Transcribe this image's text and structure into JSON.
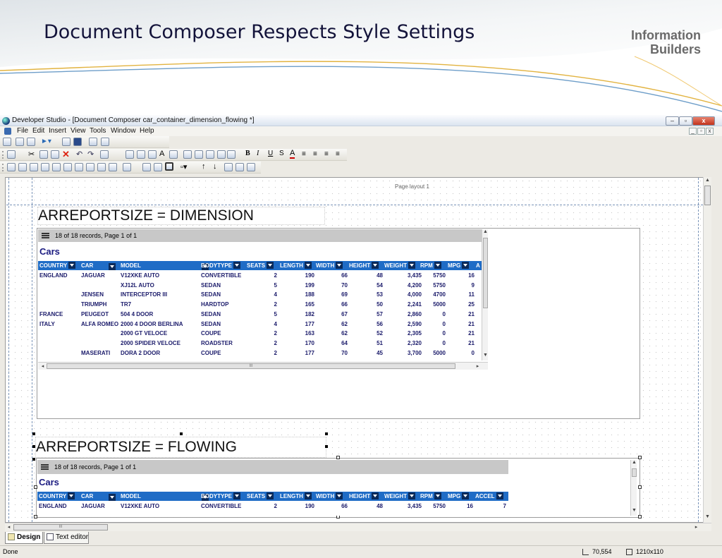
{
  "slide": {
    "title": "Document Composer Respects Style Settings",
    "logo_line1": "Information",
    "logo_line2": "Builders"
  },
  "window": {
    "title": "Developer Studio - [Document Composer car_container_dimension_flowing *]",
    "controls": [
      "–",
      "▫",
      "x"
    ],
    "mdi_controls": [
      "_",
      "▫",
      "x"
    ]
  },
  "menu": [
    "File",
    "Edit",
    "Insert",
    "View",
    "Tools",
    "Window",
    "Help"
  ],
  "format_toolbar": {
    "bold": "B",
    "italic": "I",
    "underline": "U",
    "strike": "S",
    "color": "A"
  },
  "canvas": {
    "page_label": "Page layout 1"
  },
  "report1": {
    "title": "ARREPORTSIZE = DIMENSION",
    "pager": "18 of 18 records, Page 1 of 1",
    "heading": "Cars",
    "columns": [
      "COUNTRY",
      "CAR",
      "MODEL",
      "BODYTYPE",
      "SEATS",
      "LENGTH",
      "WIDTH",
      "HEIGHT",
      "WEIGHT",
      "RPM",
      "MPG",
      "A"
    ],
    "rows": [
      [
        "ENGLAND",
        "JAGUAR",
        "V12XKE AUTO",
        "CONVERTIBLE",
        "2",
        "190",
        "66",
        "48",
        "3,435",
        "5750",
        "16"
      ],
      [
        "",
        "",
        "XJ12L AUTO",
        "SEDAN",
        "5",
        "199",
        "70",
        "54",
        "4,200",
        "5750",
        "9"
      ],
      [
        "",
        "JENSEN",
        "INTERCEPTOR III",
        "SEDAN",
        "4",
        "188",
        "69",
        "53",
        "4,000",
        "4700",
        "11"
      ],
      [
        "",
        "TRIUMPH",
        "TR7",
        "HARDTOP",
        "2",
        "165",
        "66",
        "50",
        "2,241",
        "5000",
        "25"
      ],
      [
        "FRANCE",
        "PEUGEOT",
        "504 4 DOOR",
        "SEDAN",
        "5",
        "182",
        "67",
        "57",
        "2,860",
        "0",
        "21"
      ],
      [
        "ITALY",
        "ALFA ROMEO",
        "2000 4 DOOR BERLINA",
        "SEDAN",
        "4",
        "177",
        "62",
        "56",
        "2,590",
        "0",
        "21"
      ],
      [
        "",
        "",
        "2000 GT VELOCE",
        "COUPE",
        "2",
        "163",
        "62",
        "52",
        "2,305",
        "0",
        "21"
      ],
      [
        "",
        "",
        "2000 SPIDER VELOCE",
        "ROADSTER",
        "2",
        "170",
        "64",
        "51",
        "2,320",
        "0",
        "21"
      ],
      [
        "",
        "MASERATI",
        "DORA 2 DOOR",
        "COUPE",
        "2",
        "177",
        "70",
        "45",
        "3,700",
        "5000",
        "0"
      ]
    ],
    "hscroll_grip": "III"
  },
  "report2": {
    "title": "ARREPORTSIZE = FLOWING",
    "pager": "18 of 18 records, Page 1 of 1",
    "heading": "Cars",
    "columns": [
      "COUNTRY",
      "CAR",
      "MODEL",
      "BODYTYPE",
      "SEATS",
      "LENGTH",
      "WIDTH",
      "HEIGHT",
      "WEIGHT",
      "RPM",
      "MPG",
      "ACCEL"
    ],
    "rows": [
      [
        "ENGLAND",
        "JAGUAR",
        "V12XKE AUTO",
        "CONVERTIBLE",
        "2",
        "190",
        "66",
        "48",
        "3,435",
        "5750",
        "16",
        "7"
      ]
    ]
  },
  "bottom_tabs": [
    "Design",
    "Text editor"
  ],
  "status": {
    "left": "Done",
    "position": "70,554",
    "size": "1210x110"
  },
  "hscroll_grip": "III"
}
